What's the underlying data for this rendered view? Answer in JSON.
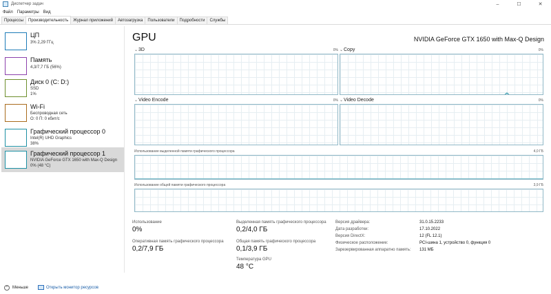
{
  "window": {
    "title": "Диспетчер задач"
  },
  "menu": [
    "Файл",
    "Параметры",
    "Вид"
  ],
  "tabs": [
    {
      "label": "Процессы",
      "active": false
    },
    {
      "label": "Производительность",
      "active": true
    },
    {
      "label": "Журнал приложений",
      "active": false
    },
    {
      "label": "Автозагрузка",
      "active": false
    },
    {
      "label": "Пользователи",
      "active": false
    },
    {
      "label": "Подробности",
      "active": false
    },
    {
      "label": "Службы",
      "active": false
    }
  ],
  "sidebar": {
    "items": [
      {
        "title": "ЦП",
        "lines": [
          "3% 2,29 ГГц"
        ],
        "color": "#1b7ab7",
        "selected": false
      },
      {
        "title": "Память",
        "lines": [
          "4,3/7,7 ГБ (56%)"
        ],
        "color": "#8b3fab",
        "selected": false
      },
      {
        "title": "Диск 0 (C: D:)",
        "lines": [
          "SSD",
          "1%"
        ],
        "color": "#6d8e2b",
        "selected": false
      },
      {
        "title": "Wi-Fi",
        "lines": [
          "Беспроводная сеть",
          "О: 0 П: 0 кбит/с"
        ],
        "color": "#a86a1b",
        "selected": false
      },
      {
        "title": "Графический процессор 0",
        "lines": [
          "Intel(R) UHD Graphics",
          "38%"
        ],
        "color": "#1b8fa3",
        "selected": false
      },
      {
        "title": "Графический процессор 1",
        "lines": [
          "NVIDIA GeForce GTX 1650 with Max-Q Design",
          "0% (48 °C)"
        ],
        "color": "#1b8fa3",
        "selected": true
      }
    ]
  },
  "main": {
    "title": "GPU",
    "model": "NVIDIA GeForce GTX 1650 with Max-Q Design",
    "engines": [
      {
        "name": "3D",
        "pct": "0%"
      },
      {
        "name": "Copy",
        "pct": "0%"
      },
      {
        "name": "Video Encode",
        "pct": "0%"
      },
      {
        "name": "Video Decode",
        "pct": "0%"
      }
    ],
    "dedicated_mem": {
      "label": "Использование выделенной памяти графического процессора",
      "max": "4,0 ГБ"
    },
    "shared_mem": {
      "label": "Использование общей памяти графического процессора",
      "max": "3,9 ГБ"
    }
  },
  "stats": {
    "utilization_label": "Использование",
    "utilization_value": "0%",
    "gpu_mem_label": "Оперативная память графического процессора",
    "gpu_mem_value": "0,2/7,9 ГБ",
    "dedicated_label": "Выделенная память графического процессора",
    "dedicated_value": "0,2/4,0 ГБ",
    "shared_label": "Общая память графического процессора",
    "shared_value": "0,1/3,9 ГБ",
    "temp_label": "Температура GPU",
    "temp_value": "48 °C"
  },
  "info": [
    {
      "key": "Версия драйвера:",
      "value": "31.0.15.2233"
    },
    {
      "key": "Дата разработки:",
      "value": "17.10.2022"
    },
    {
      "key": "Версия DirectX:",
      "value": "12 (FL 12.1)"
    },
    {
      "key": "Физическое расположение:",
      "value": "PCI-шина 1, устройство 0, функция 0"
    },
    {
      "key": "Зарезервированная аппаратно память:",
      "value": "131 МБ"
    }
  ],
  "footer": {
    "less_label": "Меньше",
    "monitor_link": "Открыть монитор ресурсов"
  }
}
